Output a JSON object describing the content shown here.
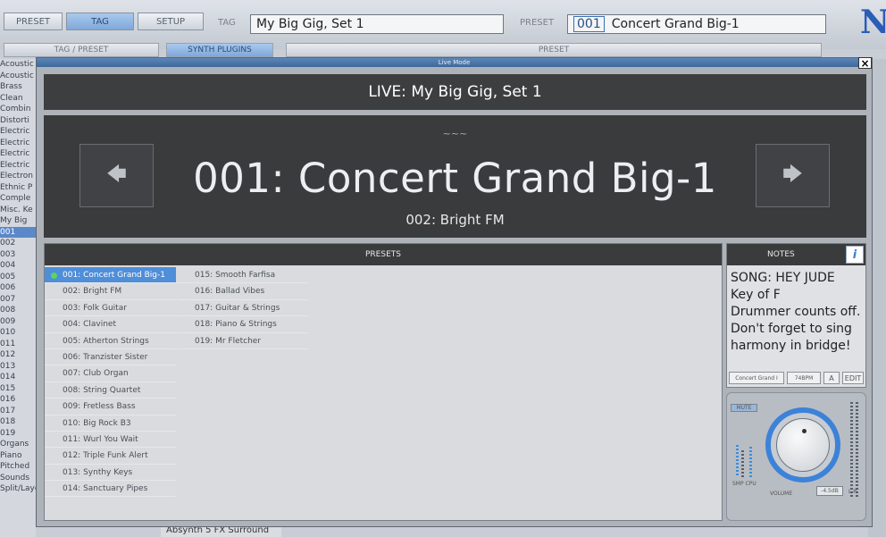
{
  "toolbar": {
    "preset_tab": "PRESET",
    "tag_tab": "TAG",
    "setup_tab": "SETUP",
    "tag_label": "TAG",
    "tag_value": "My Big Gig, Set 1",
    "preset_label": "PRESET",
    "preset_num": "001",
    "preset_value": "Concert Grand Big-1",
    "tag_preset_tab": "TAG / PRESET",
    "synth_plugins_tab": "SYNTH PLUGINS",
    "sub_preset_label": "PRESET"
  },
  "sidebar": {
    "items": [
      "Acoustic",
      "Acoustic",
      "Brass",
      "Clean",
      "Combin",
      "Distorti",
      "Electric",
      "Electric",
      "Electric",
      "Electric",
      "Electron",
      "Ethnic P",
      "Comple",
      "Misc. Ke",
      "My Big",
      "001",
      "002",
      "003",
      "004",
      "005",
      "006",
      "007",
      "008",
      "009",
      "010",
      "011",
      "012",
      "013",
      "014",
      "015",
      "016",
      "017",
      "018",
      "019",
      "Organs",
      "Piano",
      "Pitched",
      "Sounds",
      "Split/Layer"
    ]
  },
  "bottom_bar": {
    "plugin": "Absynth 5 FX Surround"
  },
  "modal": {
    "window_title": "Live Mode",
    "close_label": "×",
    "live_title": "LIVE: My Big Gig, Set 1",
    "separator": "~~~",
    "current_preset": "001: Concert Grand Big-1",
    "next_preset": "002: Bright FM",
    "prev_arrow": "🡄",
    "next_arrow": "🡆",
    "presets_header": "PRESETS",
    "presets_col1": [
      "001: Concert Grand Big-1",
      "002: Bright FM",
      "003: Folk Guitar",
      "004: Clavinet",
      "005: Atherton Strings",
      "006: Tranzister Sister",
      "007: Club Organ",
      "008: String Quartet",
      "009: Fretless Bass",
      "010: Big Rock B3",
      "011: Wurl You Wait",
      "012: Triple Funk Alert",
      "013: Synthy Keys",
      "014: Sanctuary Pipes"
    ],
    "presets_col2": [
      "015: Smooth Farfisa",
      "016: Ballad Vibes",
      "017: Guitar & Strings",
      "018: Piano & Strings",
      "019: Mr Fletcher"
    ],
    "notes_header": "NOTES",
    "notes_info": "i",
    "notes_text": [
      "SONG: HEY JUDE",
      "Key of F",
      "Drummer counts off.",
      "Don't forget to sing",
      "harmony in bridge!"
    ],
    "notes_footer": {
      "preset": "Concert Grand I",
      "bpm": "74BPM",
      "transpose": "A",
      "edit": "EDIT"
    },
    "mixer": {
      "volume_label": "VOLUME",
      "db_value": "-4.5dB",
      "lr_label": "L R",
      "meter_labels": "SMP CPU",
      "mute_label": "MUTE"
    }
  }
}
